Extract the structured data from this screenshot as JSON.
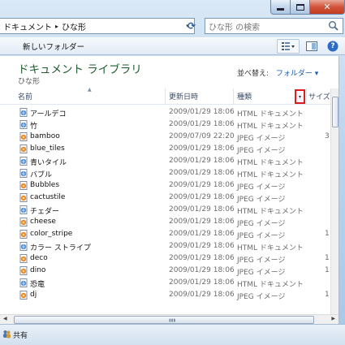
{
  "window": {
    "caption": {
      "close_glyph": "✕"
    }
  },
  "address": {
    "crumbs": [
      "ドキュメント",
      "ひな形"
    ],
    "separator": "▸",
    "dropdown_glyph": "▾",
    "refresh_glyph": "⟳"
  },
  "search": {
    "placeholder": "ひな形 の検索"
  },
  "toolbar": {
    "new_folder_label": "新しいフォルダー",
    "views_icon": "views-icon",
    "help_glyph": "?"
  },
  "library": {
    "title": "ドキュメント ライブラリ",
    "subtitle": "ひな形",
    "arrange_label": "並べ替え:",
    "arrange_value": "フォルダー ▾"
  },
  "columns": {
    "name": "名前",
    "date": "更新日時",
    "type": "種類",
    "size": "サイズ",
    "sort_caret": "▲",
    "dropdown_glyph": "▾"
  },
  "files": [
    {
      "name": "アールデコ",
      "date": "2009/01/29 18:06",
      "type": "HTML ドキュメント",
      "size": "",
      "icon": "html"
    },
    {
      "name": "竹",
      "date": "2009/01/29 18:06",
      "type": "HTML ドキュメント",
      "size": "",
      "icon": "html"
    },
    {
      "name": "bamboo",
      "date": "2009/07/09 22:20",
      "type": "JPEG イメージ",
      "size": "3",
      "icon": "jpeg"
    },
    {
      "name": "blue_tiles",
      "date": "2009/01/29 18:06",
      "type": "JPEG イメージ",
      "size": "",
      "icon": "jpeg"
    },
    {
      "name": "青いタイル",
      "date": "2009/01/29 18:06",
      "type": "HTML ドキュメント",
      "size": "",
      "icon": "html"
    },
    {
      "name": "バブル",
      "date": "2009/01/29 18:06",
      "type": "HTML ドキュメント",
      "size": "",
      "icon": "html"
    },
    {
      "name": "Bubbles",
      "date": "2009/01/29 18:06",
      "type": "JPEG イメージ",
      "size": "",
      "icon": "jpeg"
    },
    {
      "name": "cactustile",
      "date": "2009/01/29 18:06",
      "type": "JPEG イメージ",
      "size": "",
      "icon": "jpeg"
    },
    {
      "name": "チェダー",
      "date": "2009/01/29 18:06",
      "type": "HTML ドキュメント",
      "size": "",
      "icon": "html"
    },
    {
      "name": "cheese",
      "date": "2009/01/29 18:06",
      "type": "JPEG イメージ",
      "size": "",
      "icon": "jpeg"
    },
    {
      "name": "color_stripe",
      "date": "2009/01/29 18:06",
      "type": "JPEG イメージ",
      "size": "1",
      "icon": "jpeg"
    },
    {
      "name": "カラー ストライプ",
      "date": "2009/01/29 18:06",
      "type": "HTML ドキュメント",
      "size": "",
      "icon": "html"
    },
    {
      "name": "deco",
      "date": "2009/01/29 18:06",
      "type": "JPEG イメージ",
      "size": "1",
      "icon": "jpeg"
    },
    {
      "name": "dino",
      "date": "2009/01/29 18:06",
      "type": "JPEG イメージ",
      "size": "1",
      "icon": "jpeg"
    },
    {
      "name": "恐竜",
      "date": "2009/01/29 18:06",
      "type": "HTML ドキュメント",
      "size": "",
      "icon": "html"
    },
    {
      "name": "dj",
      "date": "2009/01/29 18:06",
      "type": "JPEG イメージ",
      "size": "1",
      "icon": "jpeg"
    }
  ],
  "statusbar": {
    "share_label": "共有"
  },
  "colors": {
    "library_title": "#1e5c2e",
    "highlight_box": "#e01c1c",
    "link_blue": "#1b5cab"
  }
}
